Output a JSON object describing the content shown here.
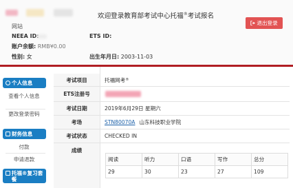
{
  "header": {
    "welcome_prefix": "欢迎登录教育部考试中心托福",
    "welcome_reg": "®",
    "welcome_suffix": "考试报名",
    "site_suffix": "网站",
    "logout_label": "退出登录"
  },
  "profile": {
    "neea_id_label": "NEEA ID:",
    "ets_id_label": "ETS ID:",
    "balance_label": "账户余额:",
    "balance_value": "RMB¥0.00",
    "gender_label": "性别:",
    "gender_value": "女",
    "dob_label": "出生年月日:",
    "dob_value": "2003-11-03"
  },
  "sidebar": {
    "personal_section": "个人信息",
    "view_personal": "查看个人信息",
    "change_password": "更改登录密码",
    "finance_section": "财务信息",
    "payment": "付款",
    "refund": "申请退款",
    "toefl_section": "托福®复习套餐"
  },
  "exam": {
    "item_label": "考试项目",
    "item_value": "托福网考",
    "item_reg": "®",
    "ets_reg_label": "ETS注册号",
    "date_label": "考试日期",
    "date_value": "2019年6月29日 星期六",
    "venue_label": "考场",
    "venue_code": "STN80070A",
    "venue_name": "山东科技职业学院",
    "status_label": "考试状态",
    "status_value": "CHECKED IN",
    "score_label": "成绩"
  },
  "scores": {
    "headers": [
      "阅读",
      "听力",
      "口语",
      "写作",
      "总分"
    ],
    "values": [
      "29",
      "30",
      "23",
      "27",
      "109"
    ]
  }
}
